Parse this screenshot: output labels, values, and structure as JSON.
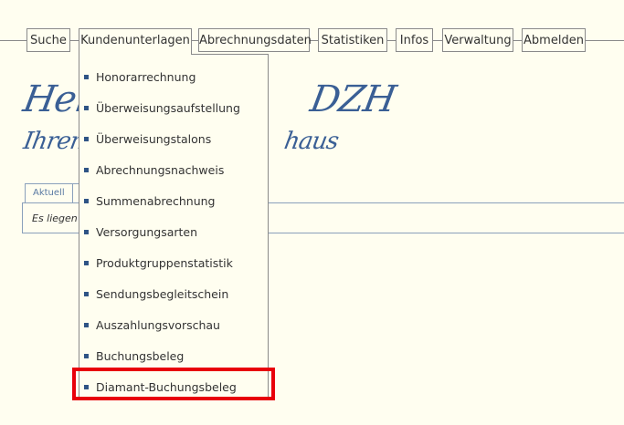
{
  "nav": {
    "items": [
      {
        "label": "Suche"
      },
      {
        "label": "Kundenunterlagen",
        "active": true
      },
      {
        "label": "Abrechnungsdaten"
      },
      {
        "label": "Statistiken"
      },
      {
        "label": "Infos"
      },
      {
        "label": "Verwaltung"
      },
      {
        "label": "Abmelden"
      }
    ]
  },
  "dropdown": {
    "items": [
      {
        "label": "Honorarrechnung"
      },
      {
        "label": "Überweisungsaufstellung"
      },
      {
        "label": "Überweisungstalons"
      },
      {
        "label": "Abrechnungsnachweis"
      },
      {
        "label": "Summenabrechnung"
      },
      {
        "label": "Versorgungsarten"
      },
      {
        "label": "Produktgruppenstatistik"
      },
      {
        "label": "Sendungsbegleitschein"
      },
      {
        "label": "Auszahlungsvorschau"
      },
      {
        "label": "Buchungsbeleg"
      },
      {
        "label": "Diamant-Buchungsbeleg",
        "highlighted": true
      }
    ],
    "highlight_color": "#e8000b"
  },
  "greeting": {
    "line1": "Herzli",
    "line1_end": "DZH",
    "line2": "Ihrem p",
    "line2_end": "haus"
  },
  "tabs": {
    "active_label": "Aktuell"
  },
  "panel": {
    "text": "Es liegen"
  },
  "colors": {
    "background": "#fffef0",
    "accent_blue": "#3a5f95",
    "border": "#8a8a8a"
  }
}
